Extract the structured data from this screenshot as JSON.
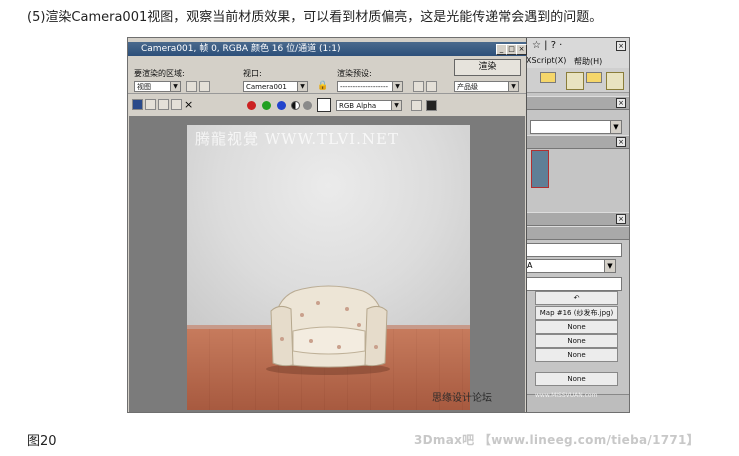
{
  "article": {
    "caption": "(5)渲染Camera001视图，观察当前材质效果，可以看到材质偏亮，这是光能传递常会遇到的问题。",
    "figure_label": "图20",
    "footer_watermark": "3Dmax吧 【www.lineeg.com/tieba/1771】"
  },
  "render_window": {
    "title": "Camera001, 帧 0, RGBA 颜色 16 位/通道 (1:1)",
    "area_label": "要渲染的区域:",
    "area_value": "视图",
    "viewport_label": "视口:",
    "viewport_value": "Camera001",
    "preset_label": "渲染预设:",
    "preset_value": "-------------------",
    "render_button": "渲染",
    "production_value": "产品级",
    "channel_value": "RGB Alpha"
  },
  "image_watermarks": {
    "top": "腾龍视覺 WWW.TLVI.NET",
    "bottom_cn": "思缘设计论坛",
    "bottom_url": "www.MISSVUAN.com"
  },
  "max_panel": {
    "toolbar_text": "☆ | ? ·",
    "menu_script": "XScript(X)",
    "menu_help": "帮助(H)",
    "map_button": "Map #16 (纱发布.jpg)",
    "none_1": "None",
    "none_2": "None",
    "none_3": "None",
    "none_4": "None",
    "dropdown_text": "A"
  },
  "colors": {
    "red": "#cc2222",
    "green": "#22a022",
    "blue": "#2244cc"
  }
}
